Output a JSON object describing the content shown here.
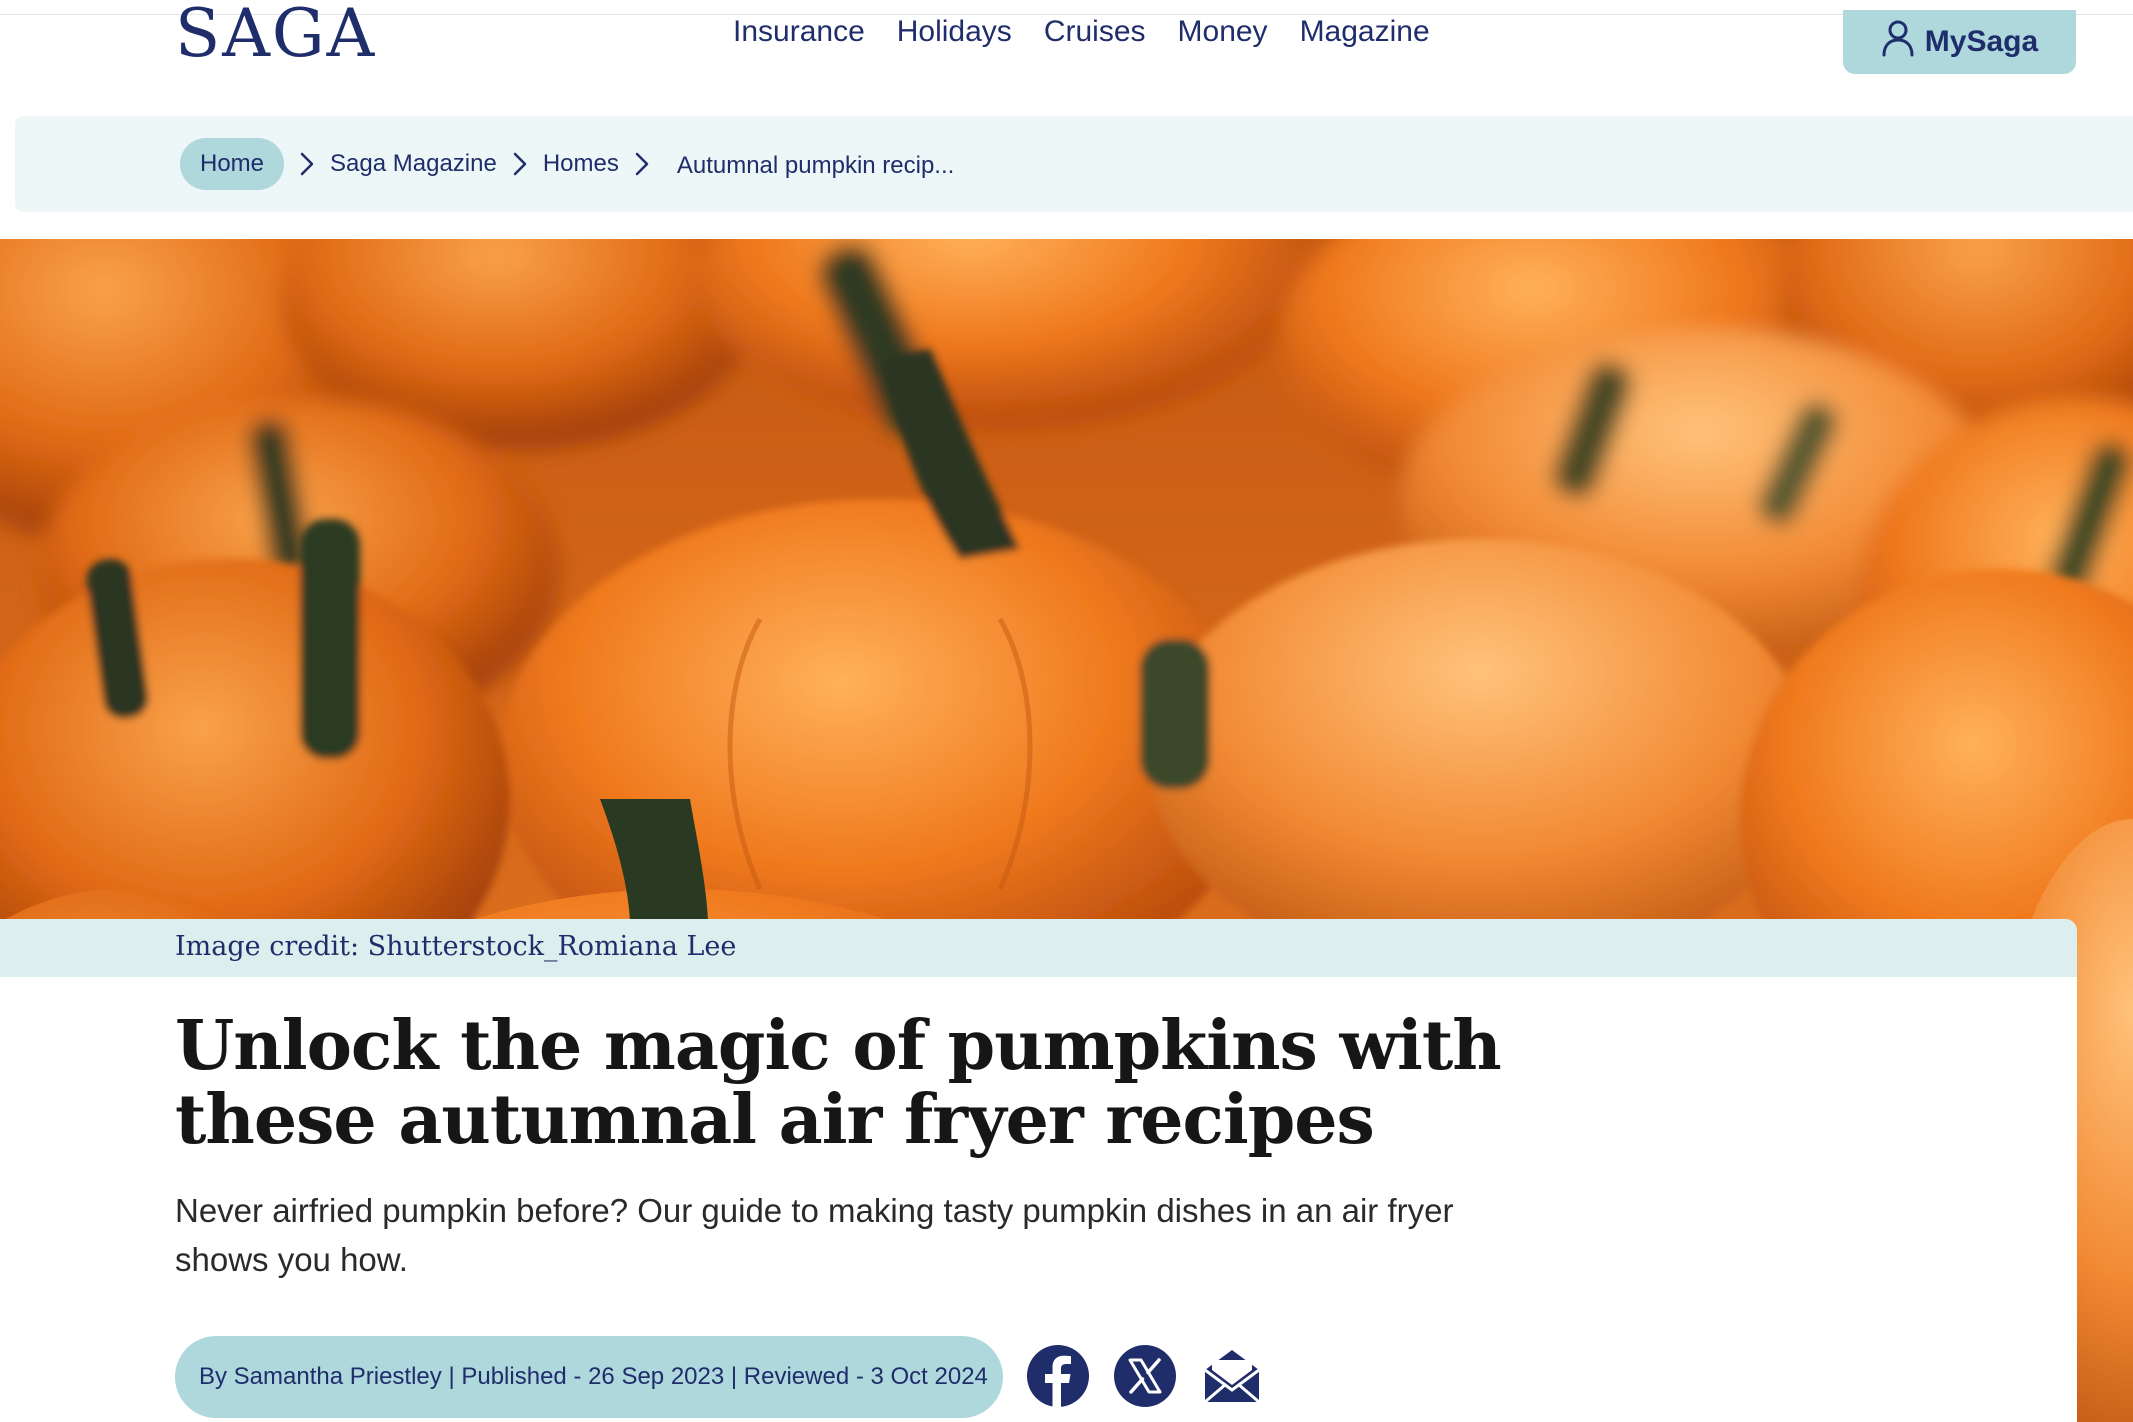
{
  "header": {
    "logo": "SAGA",
    "nav": [
      "Insurance",
      "Holidays",
      "Cruises",
      "Money",
      "Magazine"
    ],
    "account_label": "MySaga"
  },
  "breadcrumb": {
    "home": "Home",
    "items": [
      "Saga Magazine",
      "Homes"
    ],
    "current": "Autumnal pumpkin recip..."
  },
  "hero": {
    "credit": "Image credit: Shutterstock_Romiana Lee"
  },
  "article": {
    "title_line1": "Unlock the magic of pumpkins with",
    "title_line2": "these autumnal air fryer recipes",
    "standfirst": "Never airfried pumpkin before? Our guide to making tasty pumpkin dishes in an air fryer shows you how.",
    "byline": "By Samantha Priestley | Published - 26 Sep 2023 | Reviewed - 3 Oct 2024"
  },
  "share": {
    "icons": [
      "facebook-icon",
      "x-icon",
      "email-icon"
    ]
  },
  "colors": {
    "navy": "#1f2d6b",
    "teal": "#aed8dc",
    "light_teal": "#eef7f7",
    "pumpkin": "#f0872b"
  }
}
